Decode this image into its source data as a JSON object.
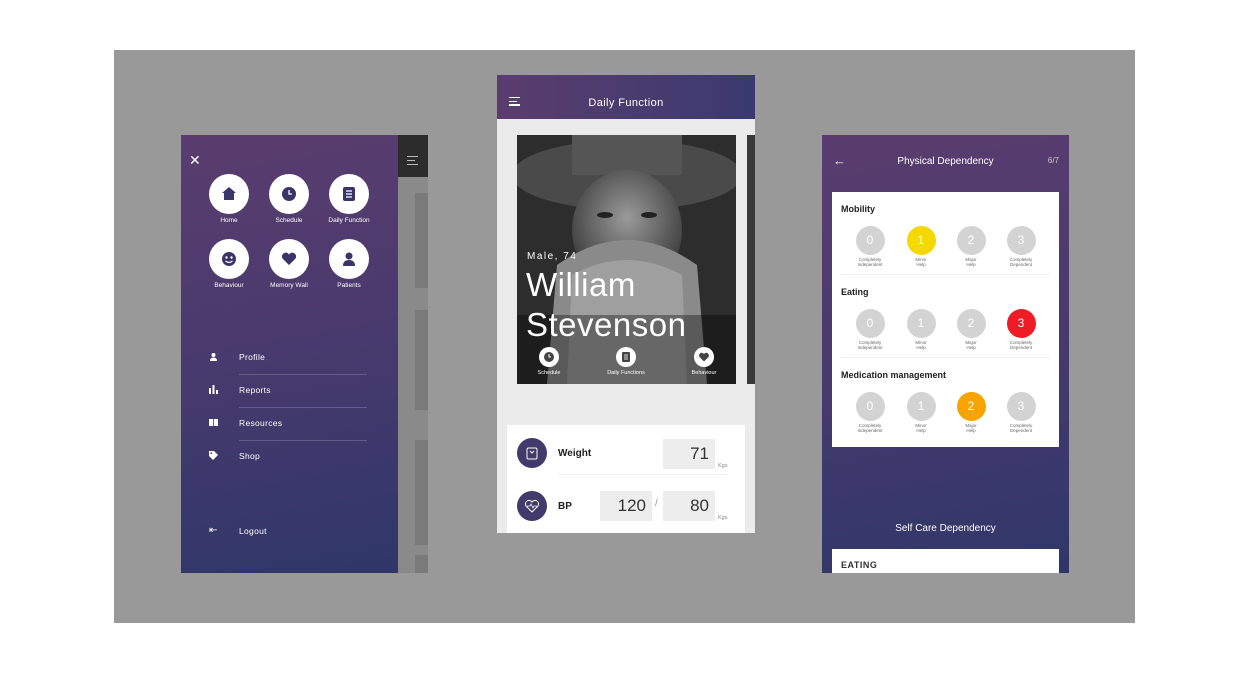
{
  "menu_screen": {
    "tiles": [
      {
        "label": "Home",
        "icon": "home-icon"
      },
      {
        "label": "Schedule",
        "icon": "clock-icon"
      },
      {
        "label": "Daily Function",
        "icon": "list-icon"
      },
      {
        "label": "Behaviour",
        "icon": "face-icon"
      },
      {
        "label": "Memory Wall",
        "icon": "heart-icon"
      },
      {
        "label": "Patients",
        "icon": "person-icon"
      }
    ],
    "items": [
      {
        "label": "Profile",
        "icon": "person-icon"
      },
      {
        "label": "Reports",
        "icon": "bar-chart-icon"
      },
      {
        "label": "Resources",
        "icon": "book-icon"
      },
      {
        "label": "Shop",
        "icon": "tag-icon"
      }
    ],
    "logout": "Logout"
  },
  "daily_screen": {
    "title": "Daily Function",
    "patient_meta": "Male, 74",
    "first_name": "William",
    "last_name": "Stevenson",
    "quick_actions": [
      {
        "label": "Schedule",
        "icon": "clock-icon"
      },
      {
        "label": "Daily Functions",
        "icon": "list-icon"
      },
      {
        "label": "Behaviour",
        "icon": "heart-icon"
      }
    ],
    "weight": {
      "label": "Weight",
      "value": "71",
      "unit": "Kgs"
    },
    "bp": {
      "label": "BP",
      "systolic": "120",
      "separator": "/",
      "diastolic": "80",
      "unit": "Kgs"
    }
  },
  "dependency_screen": {
    "title": "Physical Dependency",
    "page": "6/7",
    "sections": [
      {
        "name": "Mobility",
        "selected": 1,
        "selected_color": "#f5d800"
      },
      {
        "name": "Eating",
        "selected": 3,
        "selected_color": "#ee1c25"
      },
      {
        "name": "Medication management",
        "selected": 2,
        "selected_color": "#f7a300"
      }
    ],
    "options": [
      {
        "value": "0",
        "line1": "Completely",
        "line2": "Independent"
      },
      {
        "value": "1",
        "line1": "Minor",
        "line2": "Help"
      },
      {
        "value": "2",
        "line1": "Major",
        "line2": "Help"
      },
      {
        "value": "3",
        "line1": "Completely",
        "line2": "Dependent"
      }
    ],
    "self_care_title": "Self Care Dependency",
    "self_care_first": "EATING"
  }
}
